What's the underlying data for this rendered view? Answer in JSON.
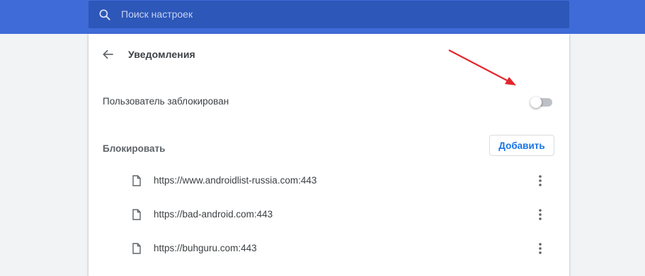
{
  "search": {
    "placeholder": "Поиск настроек"
  },
  "page": {
    "title": "Уведомления"
  },
  "setting": {
    "label": "Пользователь заблокирован",
    "toggle_state": "off"
  },
  "block": {
    "heading": "Блокировать",
    "add_label": "Добавить",
    "sites": [
      {
        "url": "https://www.androidlist-russia.com:443"
      },
      {
        "url": "https://bad-android.com:443"
      },
      {
        "url": "https://buhguru.com:443"
      }
    ]
  },
  "colors": {
    "header": "#3f6bd8",
    "search_box": "#2d57b8",
    "accent": "#1a73e8",
    "annotation_arrow": "#e3262d"
  },
  "icons": {
    "search": "search-icon",
    "back": "arrow-back-icon",
    "file": "file-icon",
    "more": "more-vert-icon"
  }
}
